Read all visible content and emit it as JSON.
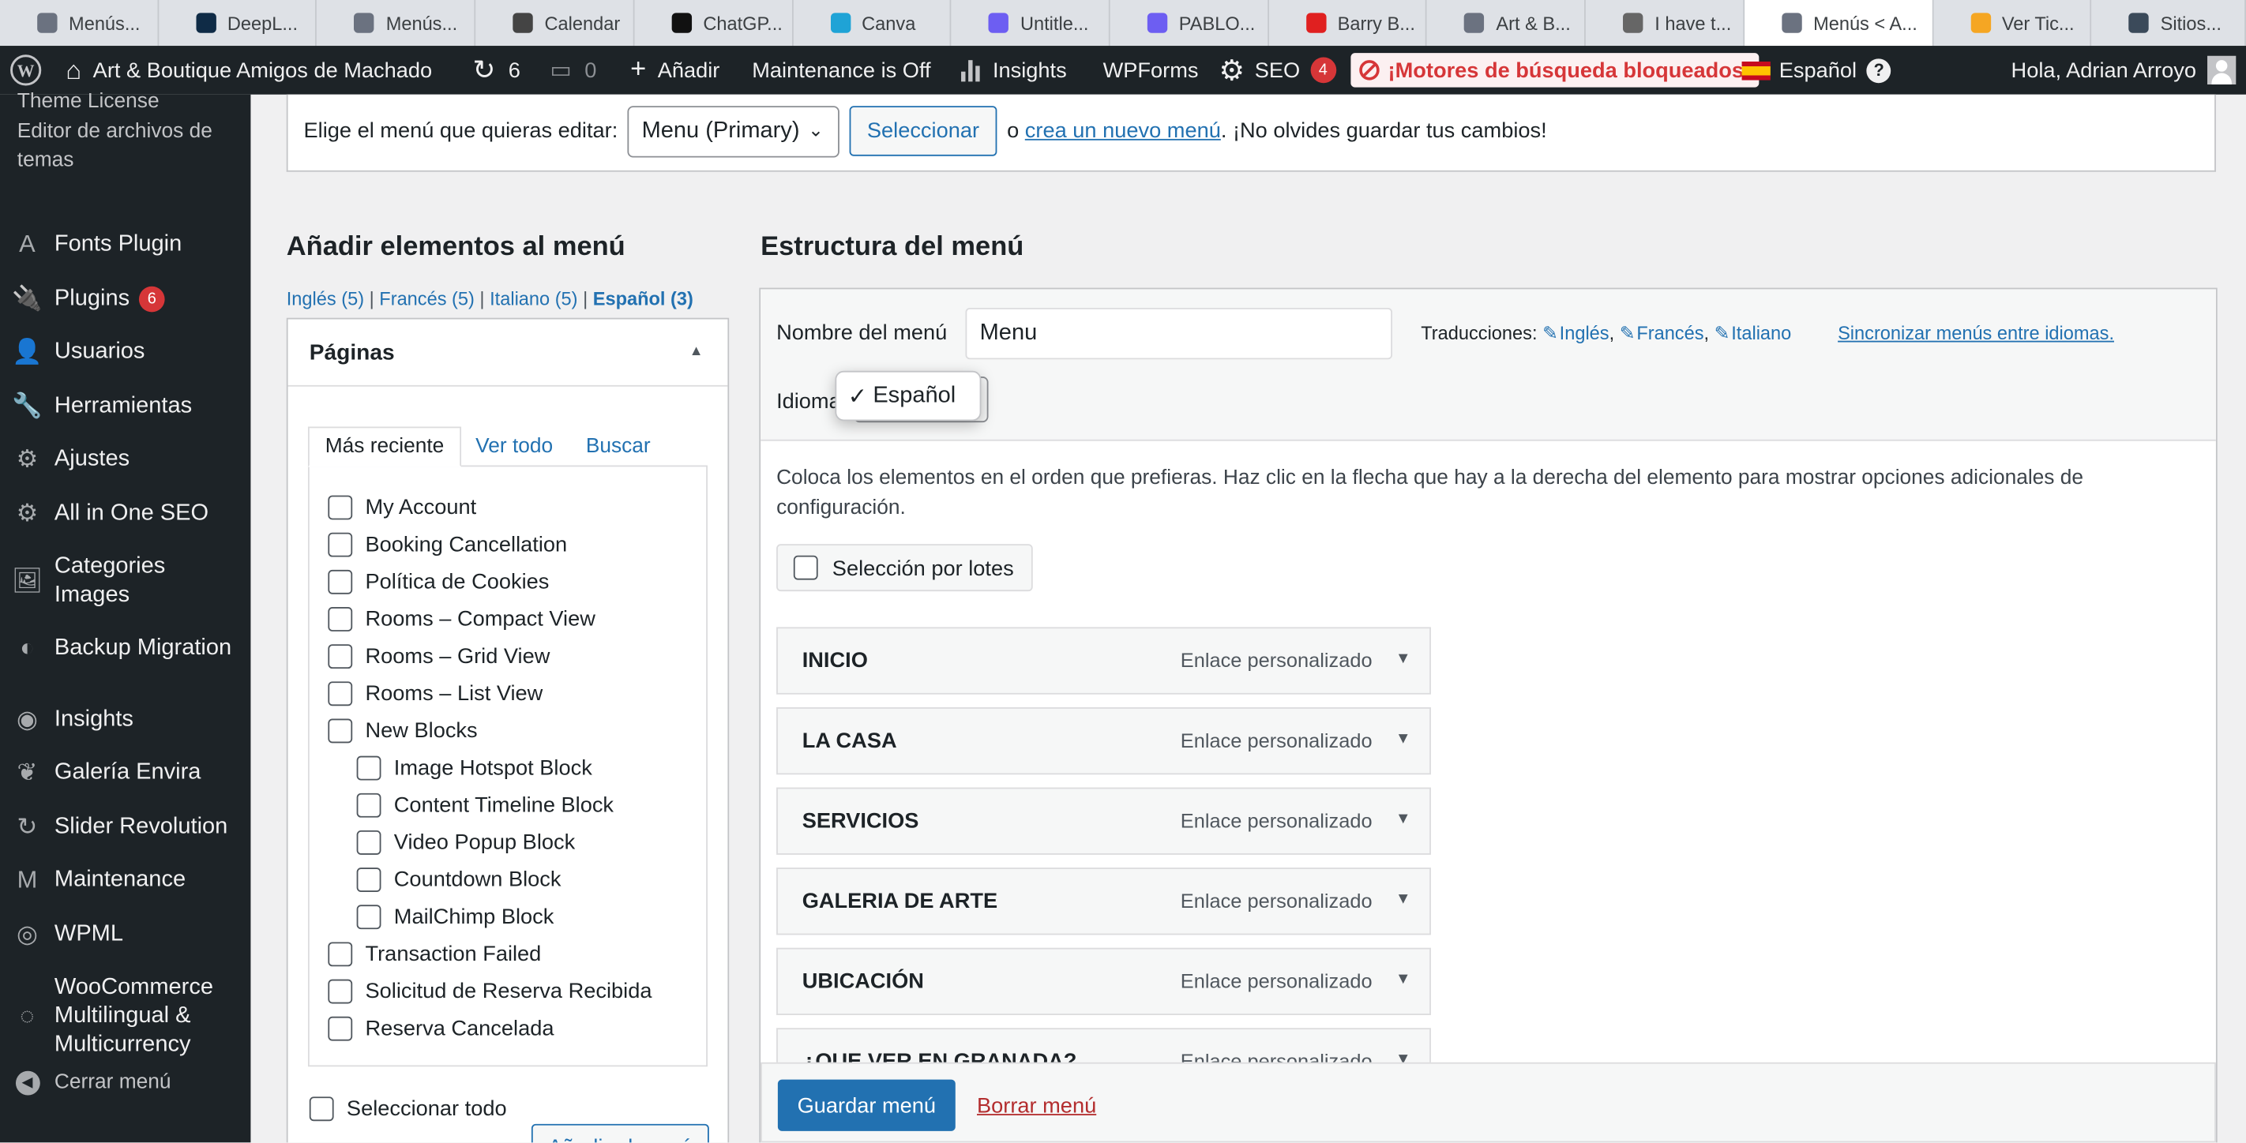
{
  "tabs": [
    {
      "label": "Menús...",
      "color": "#6b7280"
    },
    {
      "label": "DeepL...",
      "color": "#0f2b46"
    },
    {
      "label": "Menús...",
      "color": "#6b7280"
    },
    {
      "label": "Calendar",
      "color": "#444"
    },
    {
      "label": "ChatGP...",
      "color": "#111"
    },
    {
      "label": "Canva",
      "color": "#1fa3d6"
    },
    {
      "label": "Untitle...",
      "color": "#6d5ef2"
    },
    {
      "label": "PABLO...",
      "color": "#6d5ef2"
    },
    {
      "label": "Barry B...",
      "color": "#e02020"
    },
    {
      "label": "Art & B...",
      "color": "#6b7280"
    },
    {
      "label": "I have t...",
      "color": "#666"
    },
    {
      "label": "Menús < A...",
      "color": "#6b7280"
    },
    {
      "label": "Ver Tic...",
      "color": "#f5a623"
    },
    {
      "label": "Sitios...",
      "color": "#3b4a5a"
    }
  ],
  "adminbar": {
    "site_name": "Art & Boutique Amigos de Machado",
    "updates": "6",
    "comments": "0",
    "new": "Añadir",
    "maintenance": "Maintenance is Off",
    "insights": "Insights",
    "wpforms": "WPForms",
    "seo": "SEO",
    "seo_count": "4",
    "seo_alert": "¡Motores de búsqueda bloqueados!",
    "language": "Español",
    "greeting": "Hola, Adrian Arroyo"
  },
  "sidebar": {
    "theme_license": "Theme License",
    "theme_editor": "Editor de archivos de temas",
    "items": [
      {
        "label": "Fonts Plugin",
        "icon": "A"
      },
      {
        "label": "Plugins",
        "icon": "🔌",
        "badge": "6"
      },
      {
        "label": "Usuarios",
        "icon": "👤"
      },
      {
        "label": "Herramientas",
        "icon": "🔧"
      },
      {
        "label": "Ajustes",
        "icon": "⚙"
      },
      {
        "label": "All in One SEO",
        "icon": "⚙"
      },
      {
        "label": "Categories Images",
        "icon": "🖼"
      },
      {
        "label": "Backup Migration",
        "icon": "◐"
      },
      {
        "label": "Insights",
        "icon": "◉"
      },
      {
        "label": "Galería Envira",
        "icon": "❦"
      },
      {
        "label": "Slider Revolution",
        "icon": "↻"
      },
      {
        "label": "Maintenance",
        "icon": "M"
      },
      {
        "label": "WPML",
        "icon": "◎"
      },
      {
        "label": "WooCommerce Multilingual & Multicurrency",
        "icon": "◌"
      }
    ],
    "collapse": "Cerrar menú"
  },
  "menu_select": {
    "prompt": "Elige el menú que quieras editar:",
    "selected": "Menu (Primary)",
    "button": "Seleccionar",
    "or": "o",
    "create_link": "crea un nuevo menú",
    "tail": ". ¡No olvides guardar tus cambios!"
  },
  "add_items": {
    "title": "Añadir elementos al menú",
    "langs": [
      {
        "label": "Inglés (5)"
      },
      {
        "label": "Francés (5)"
      },
      {
        "label": "Italiano (5)"
      },
      {
        "label": "Español (3)"
      }
    ],
    "panel_title": "Páginas",
    "tabs": [
      "Más reciente",
      "Ver todo",
      "Buscar"
    ],
    "pages": [
      {
        "label": "My Account",
        "indent": false
      },
      {
        "label": "Booking Cancellation",
        "indent": false
      },
      {
        "label": "Política de Cookies",
        "indent": false
      },
      {
        "label": "Rooms – Compact View",
        "indent": false
      },
      {
        "label": "Rooms – Grid View",
        "indent": false
      },
      {
        "label": "Rooms – List View",
        "indent": false
      },
      {
        "label": "New Blocks",
        "indent": false
      },
      {
        "label": "Image Hotspot Block",
        "indent": true
      },
      {
        "label": "Content Timeline Block",
        "indent": true
      },
      {
        "label": "Video Popup Block",
        "indent": true
      },
      {
        "label": "Countdown Block",
        "indent": true
      },
      {
        "label": "MailChimp Block",
        "indent": true
      },
      {
        "label": "Transaction Failed",
        "indent": false
      },
      {
        "label": "Solicitud de Reserva Recibida",
        "indent": false
      },
      {
        "label": "Reserva Cancelada",
        "indent": false
      }
    ],
    "select_all": "Seleccionar todo",
    "add_button": "Añadir al menú"
  },
  "structure": {
    "title": "Estructura del menú",
    "name_label": "Nombre del menú",
    "name_value": "Menu",
    "translations_label": "Traducciones:",
    "translations": [
      "Inglés",
      "Francés",
      "Italiano"
    ],
    "sync_link": "Sincronizar menús entre idiomas.",
    "language_label": "Idioma",
    "language_option": "Español",
    "instructions": "Coloca los elementos en el orden que prefieras. Haz clic en la flecha que hay a la derecha del elemento para mostrar opciones adicionales de configuración.",
    "bulk": "Selección por lotes",
    "items": [
      {
        "title": "INICIO",
        "kind": "Enlace personalizado"
      },
      {
        "title": "LA CASA",
        "kind": "Enlace personalizado"
      },
      {
        "title": "SERVICIOS",
        "kind": "Enlace personalizado"
      },
      {
        "title": "GALERIA DE ARTE",
        "kind": "Enlace personalizado"
      },
      {
        "title": "UBICACIÓN",
        "kind": "Enlace personalizado"
      },
      {
        "title": "¿QUE VER EN GRANADA?",
        "kind": "Enlace personalizado"
      }
    ],
    "save": "Guardar menú",
    "delete": "Borrar menú"
  }
}
